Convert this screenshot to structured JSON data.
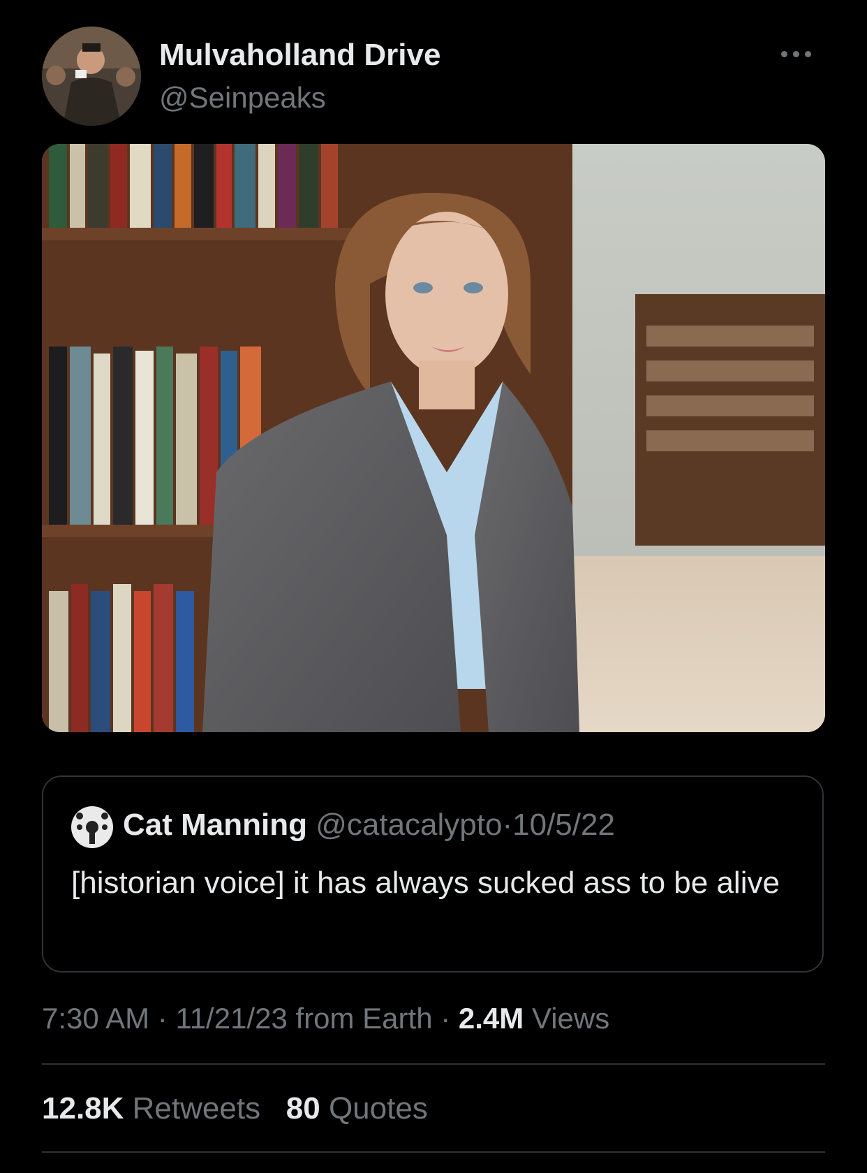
{
  "author": {
    "display_name": "Mulvaholland Drive",
    "handle": "@Seinpeaks"
  },
  "quoted_tweet": {
    "display_name": "Cat Manning",
    "handle": "@catacalypto",
    "separator": "·",
    "date": "10/5/22",
    "text": "[historian voice] it has always sucked ass to be alive"
  },
  "meta": {
    "time": "7:30 AM",
    "separator": "·",
    "date_source": "11/21/23 from Earth",
    "views_count": "2.4M",
    "views_label": "Views"
  },
  "stats": {
    "retweets_count": "12.8K",
    "retweets_label": "Retweets",
    "quotes_count": "80",
    "quotes_label": "Quotes"
  },
  "icons": {
    "more": "more-horizontal-icon"
  }
}
